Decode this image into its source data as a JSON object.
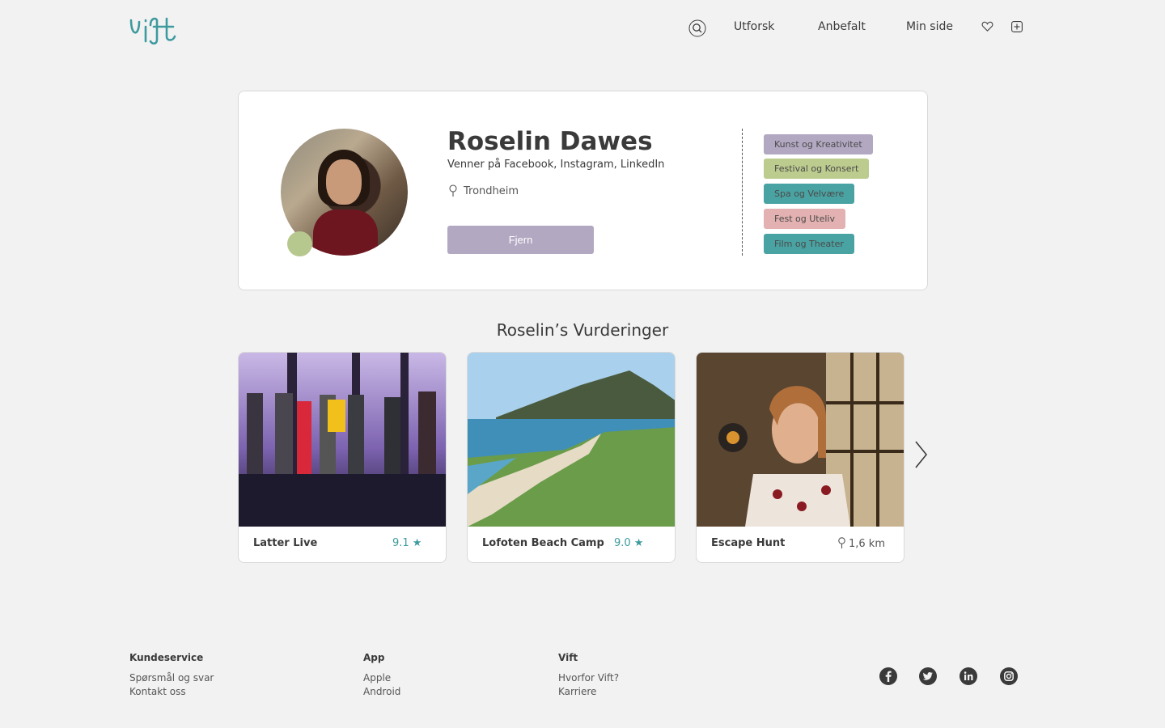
{
  "brand": {
    "logo_text": "vift",
    "accent": "#3d9a9e"
  },
  "nav": {
    "search_icon": "search-icon",
    "links": [
      "Utforsk",
      "Anbefalt",
      "Min side"
    ],
    "heart_icon": "heart-icon",
    "add_icon": "plus-square-icon"
  },
  "profile": {
    "name": "Roselin Dawes",
    "friends": "Venner på Facebook, Instagram, LinkedIn",
    "location": "Trondheim",
    "remove_label": "Fjern",
    "tags": [
      {
        "label": "Kunst og Kreativitet",
        "color": "#b3a8c2"
      },
      {
        "label": "Festival og Konsert",
        "color": "#bccb8e"
      },
      {
        "label": "Spa og Velvære",
        "color": "#4aa3a3"
      },
      {
        "label": "Fest og Uteliv",
        "color": "#e3b1b1"
      },
      {
        "label": "Film og Theater",
        "color": "#4aa3a3"
      }
    ]
  },
  "ratings": {
    "title": "Roselin’s Vurderinger",
    "cards": [
      {
        "title": "Latter Live",
        "score": "9.1 ★"
      },
      {
        "title": "Lofoten Beach Camp",
        "score": "9.0 ★"
      },
      {
        "title": "Escape Hunt",
        "distance": "1,6 km"
      }
    ]
  },
  "footer": {
    "columns": [
      {
        "heading": "Kundeservice",
        "links": [
          "Spørsmål og svar",
          "Kontakt oss"
        ]
      },
      {
        "heading": "App",
        "links": [
          "Apple",
          "Android"
        ]
      },
      {
        "heading": "Vift",
        "links": [
          "Hvorfor Vift?",
          "Karriere"
        ]
      }
    ],
    "social": [
      "facebook-icon",
      "twitter-icon",
      "linkedin-icon",
      "instagram-icon"
    ]
  }
}
